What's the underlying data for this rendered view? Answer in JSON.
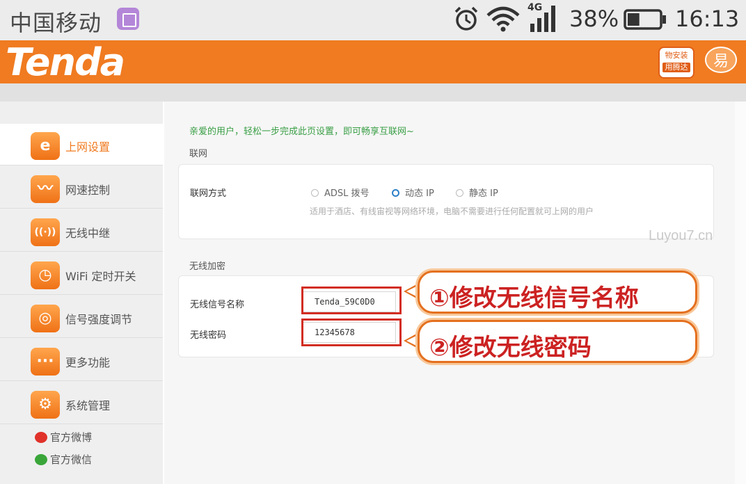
{
  "status_bar": {
    "carrier": "中国移动",
    "network_type": "4G",
    "battery_percent": "38%",
    "battery_level": 0.38,
    "time": "16:13"
  },
  "header": {
    "logo": "Tenda",
    "badge_line1": "物安装",
    "badge_line2": "用腾达",
    "seal_glyph": "易",
    "brand_color": "#f07b21"
  },
  "sidebar": {
    "items": [
      {
        "label": "上网设置",
        "icon": "ie-icon",
        "glyph": "e",
        "active": true
      },
      {
        "label": "网速控制",
        "icon": "speed-wave-icon",
        "glyph": "〰",
        "active": false
      },
      {
        "label": "无线中继",
        "icon": "repeater-icon",
        "glyph": "((·))",
        "active": false
      },
      {
        "label": "WiFi 定时开关",
        "icon": "wifi-timer-icon",
        "glyph": "◷",
        "active": false
      },
      {
        "label": "信号强度调节",
        "icon": "signal-strength-icon",
        "glyph": "◎",
        "active": false
      },
      {
        "label": "更多功能",
        "icon": "more-icon",
        "glyph": "···",
        "active": false
      },
      {
        "label": "系统管理",
        "icon": "gear-icon",
        "glyph": "⚙",
        "active": false
      }
    ],
    "social": [
      {
        "label": "官方微博",
        "icon": "weibo-icon",
        "color": "#e0322a"
      },
      {
        "label": "官方微信",
        "icon": "wechat-icon",
        "color": "#3aa63a"
      }
    ]
  },
  "main": {
    "greeting": "亲爱的用户，轻松一步完成此页设置，即可畅享互联网~",
    "internet": {
      "section_title": "联网",
      "mode_label": "联网方式",
      "options": [
        "ADSL 拨号",
        "动态 IP",
        "静态 IP"
      ],
      "selected": "动态 IP",
      "hint": "适用于酒店、有线宙视等网络环境，电脑不需要进行任何配置就可上网的用户"
    },
    "wireless": {
      "section_title": "无线加密",
      "ssid_label": "无线信号名称",
      "ssid_value": "Tenda_59C0D0",
      "password_label": "无线密码",
      "password_value": "12345678"
    }
  },
  "annotations": {
    "step1": "①修改无线信号名称",
    "step2": "②修改无线密码",
    "highlight_color": "#d22d22"
  },
  "watermark": "Luyou7.cn"
}
